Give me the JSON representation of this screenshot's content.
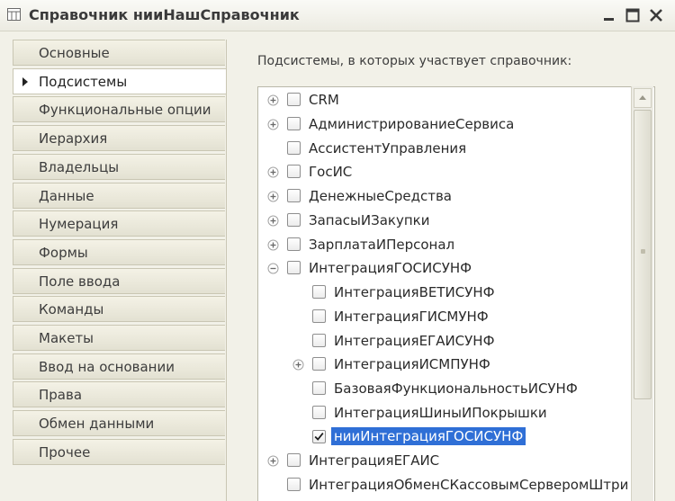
{
  "window": {
    "title": "Справочник нииНашСправочник"
  },
  "tabs": [
    {
      "label": "Основные",
      "active": false
    },
    {
      "label": "Подсистемы",
      "active": true
    },
    {
      "label": "Функциональные опции",
      "active": false
    },
    {
      "label": "Иерархия",
      "active": false
    },
    {
      "label": "Владельцы",
      "active": false
    },
    {
      "label": "Данные",
      "active": false
    },
    {
      "label": "Нумерация",
      "active": false
    },
    {
      "label": "Формы",
      "active": false
    },
    {
      "label": "Поле ввода",
      "active": false
    },
    {
      "label": "Команды",
      "active": false
    },
    {
      "label": "Макеты",
      "active": false
    },
    {
      "label": "Ввод на основании",
      "active": false
    },
    {
      "label": "Права",
      "active": false
    },
    {
      "label": "Обмен данными",
      "active": false
    },
    {
      "label": "Прочее",
      "active": false
    }
  ],
  "content": {
    "caption": "Подсистемы, в которых участвует справочник:"
  },
  "tree": [
    {
      "label": "CRM",
      "level": 0,
      "expander": "plus",
      "checked": false,
      "selected": false
    },
    {
      "label": "АдминистрированиеСервиса",
      "level": 0,
      "expander": "plus",
      "checked": false,
      "selected": false
    },
    {
      "label": "АссистентУправления",
      "level": 0,
      "expander": "none",
      "checked": false,
      "selected": false
    },
    {
      "label": "ГосИС",
      "level": 0,
      "expander": "plus",
      "checked": false,
      "selected": false
    },
    {
      "label": "ДенежныеСредства",
      "level": 0,
      "expander": "plus",
      "checked": false,
      "selected": false
    },
    {
      "label": "ЗапасыИЗакупки",
      "level": 0,
      "expander": "plus",
      "checked": false,
      "selected": false
    },
    {
      "label": "ЗарплатаИПерсонал",
      "level": 0,
      "expander": "plus",
      "checked": false,
      "selected": false
    },
    {
      "label": "ИнтеграцияГОСИСУНФ",
      "level": 0,
      "expander": "minus",
      "checked": false,
      "selected": false
    },
    {
      "label": "ИнтеграцияВЕТИСУНФ",
      "level": 1,
      "expander": "none",
      "checked": false,
      "selected": false
    },
    {
      "label": "ИнтеграцияГИСМУНФ",
      "level": 1,
      "expander": "none",
      "checked": false,
      "selected": false
    },
    {
      "label": "ИнтеграцияЕГАИСУНФ",
      "level": 1,
      "expander": "none",
      "checked": false,
      "selected": false
    },
    {
      "label": "ИнтеграцияИСМПУНФ",
      "level": 1,
      "expander": "plus",
      "checked": false,
      "selected": false
    },
    {
      "label": "БазоваяФункциональностьИСУНФ",
      "level": 1,
      "expander": "none",
      "checked": false,
      "selected": false
    },
    {
      "label": "ИнтеграцияШиныИПокрышки",
      "level": 1,
      "expander": "none",
      "checked": false,
      "selected": false
    },
    {
      "label": "нииИнтеграцияГОСИСУНФ",
      "level": 1,
      "expander": "none",
      "checked": true,
      "selected": true
    },
    {
      "label": "ИнтеграцияЕГАИС",
      "level": 0,
      "expander": "plus",
      "checked": false,
      "selected": false
    },
    {
      "label": "ИнтеграцияОбменСКассовымСерверомШтри",
      "level": 0,
      "expander": "none",
      "checked": false,
      "selected": false
    }
  ],
  "scrollbar": {
    "position_fraction": 0.0
  }
}
